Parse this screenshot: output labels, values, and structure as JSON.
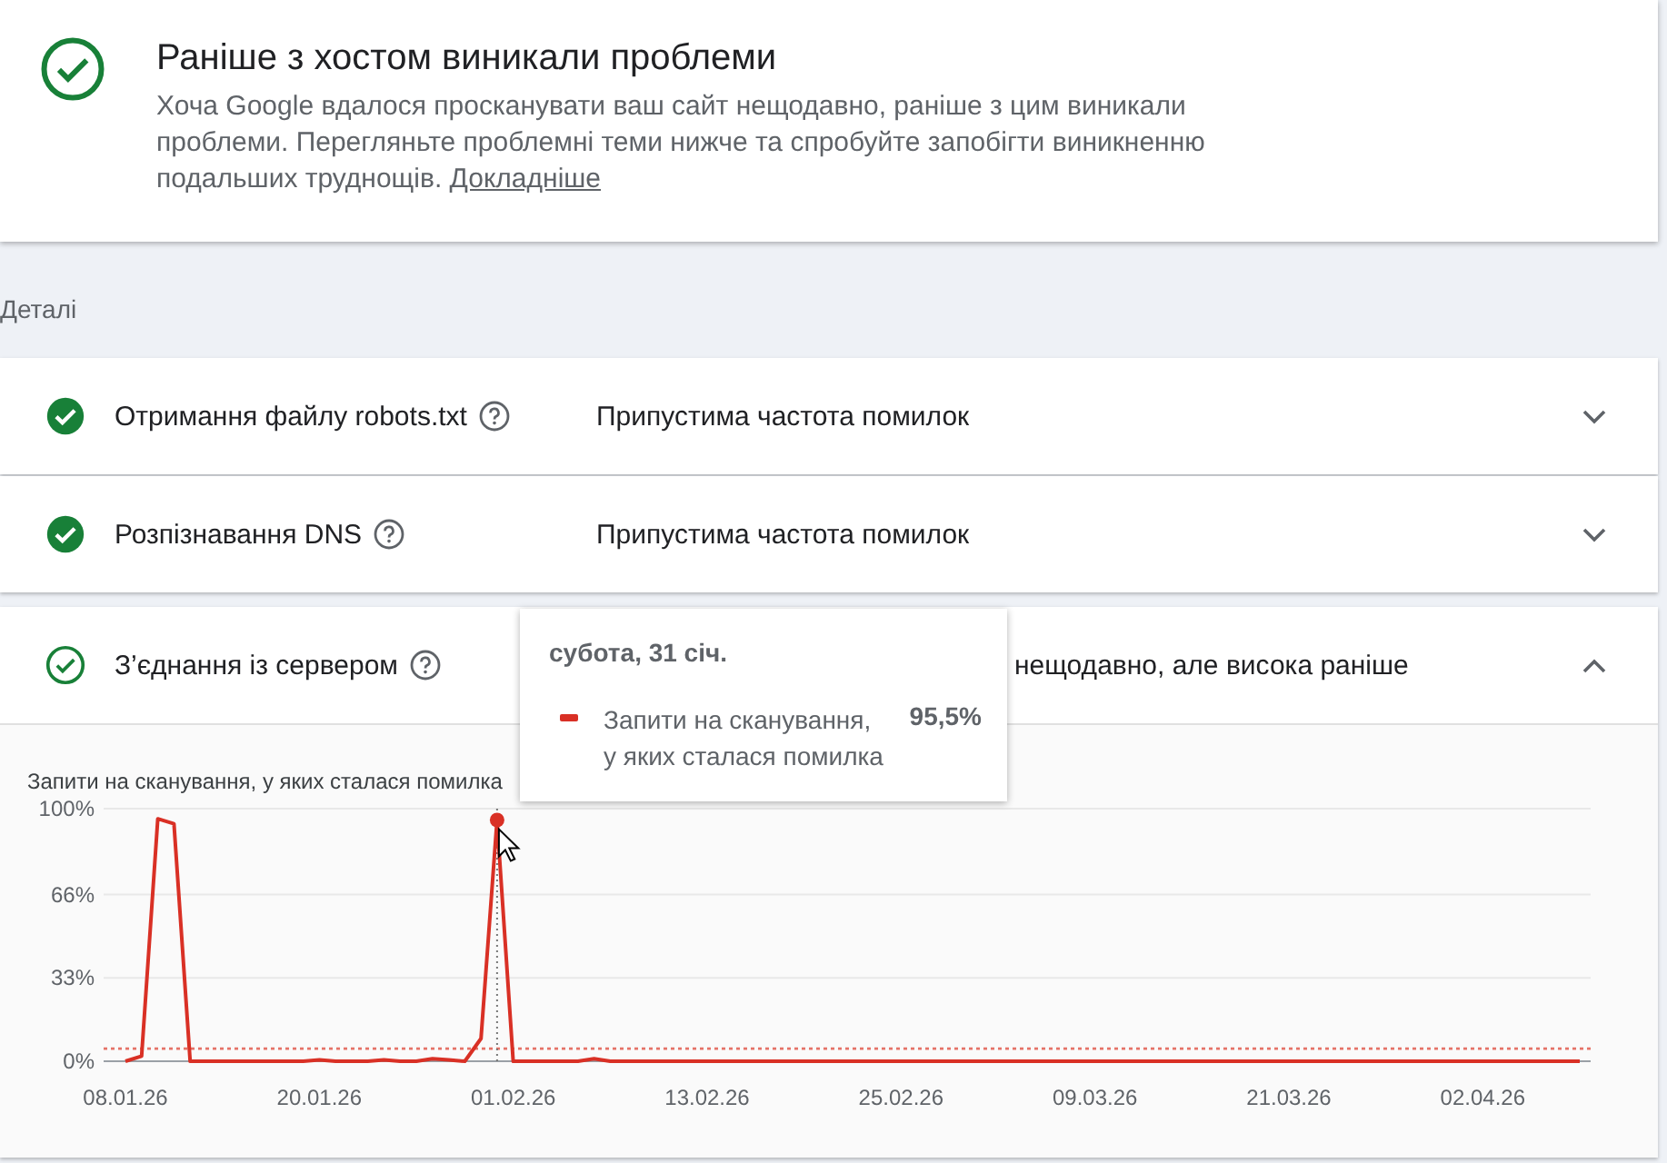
{
  "summary": {
    "title": "Раніше з хостом виникали проблеми",
    "text": "Хоча Google вдалося просканувати ваш сайт нещодавно, раніше з цим виникали проблеми. Перегляньте проблемні теми нижче та спробуйте запобігти виникненню подальших труднощів.",
    "link": "Докладніше"
  },
  "section_label": "Деталі",
  "checks": [
    {
      "label": "Отримання файлу robots.txt",
      "had_issues": false,
      "status": "Припустима частота помилок",
      "expanded": false
    },
    {
      "label": "Розпізнавання DNS",
      "had_issues": false,
      "status": "Припустима частота помилок",
      "expanded": false
    },
    {
      "label": "З’єднання із сервером",
      "had_issues": true,
      "status": "нещодавно, але висока раніше",
      "expanded": true,
      "chart_data": {
        "type": "line",
        "ylim": [
          0,
          100
        ],
        "yticks": [
          {
            "value": 0,
            "label": "0%"
          },
          {
            "value": 33,
            "label": "33%"
          },
          {
            "value": 66,
            "label": "66%"
          },
          {
            "value": 100,
            "label": "100%"
          }
        ],
        "categories": [
          "08.01.26",
          null,
          null,
          null,
          null,
          null,
          null,
          null,
          null,
          null,
          null,
          null,
          "20.01.26",
          null,
          null,
          null,
          null,
          null,
          null,
          null,
          null,
          null,
          null,
          null,
          "01.02.26",
          null,
          null,
          null,
          null,
          null,
          null,
          null,
          null,
          null,
          null,
          null,
          "13.02.26",
          null,
          null,
          null,
          null,
          null,
          null,
          null,
          null,
          null,
          null,
          null,
          "25.02.26",
          null,
          null,
          null,
          null,
          null,
          null,
          null,
          null,
          null,
          null,
          null,
          "09.03.26",
          null,
          null,
          null,
          null,
          null,
          null,
          null,
          null,
          null,
          null,
          null,
          "21.03.26",
          null,
          null,
          null,
          null,
          null,
          null,
          null,
          null,
          null,
          null,
          null,
          "02.04.26",
          null,
          null,
          null,
          null,
          null,
          null
        ],
        "series": [
          {
            "name": "Запити на сканування, у яких сталася помилка",
            "color": "#d93025",
            "values": [
              0,
              2,
              96,
              94,
              0,
              0,
              0,
              0,
              0,
              0,
              0,
              0,
              0.5,
              0,
              0,
              0,
              0.5,
              0,
              0,
              1,
              0.5,
              0,
              9,
              95.5,
              0,
              0,
              0,
              0,
              0,
              1,
              0,
              0,
              0,
              0,
              0,
              0,
              0,
              0,
              0,
              0,
              0,
              0,
              0,
              0,
              0,
              0,
              0,
              0,
              0,
              0,
              0,
              0,
              0,
              0,
              0,
              0,
              0,
              0,
              0,
              0,
              0,
              0,
              0,
              0,
              0,
              0,
              0,
              0,
              0,
              0,
              0,
              0,
              0,
              0,
              0,
              0,
              0,
              0,
              0,
              0,
              0,
              0,
              0,
              0,
              0,
              0,
              0,
              0,
              0,
              0,
              0
            ]
          }
        ],
        "ref_lines": [
          {
            "axis": "y",
            "value": 5,
            "color": "#e57368"
          }
        ]
      },
      "tooltip": {
        "title": "субота, 31 січ.",
        "series": "Запити на сканування,\nу яких сталася помилка",
        "value": "95,5%"
      }
    }
  ]
}
